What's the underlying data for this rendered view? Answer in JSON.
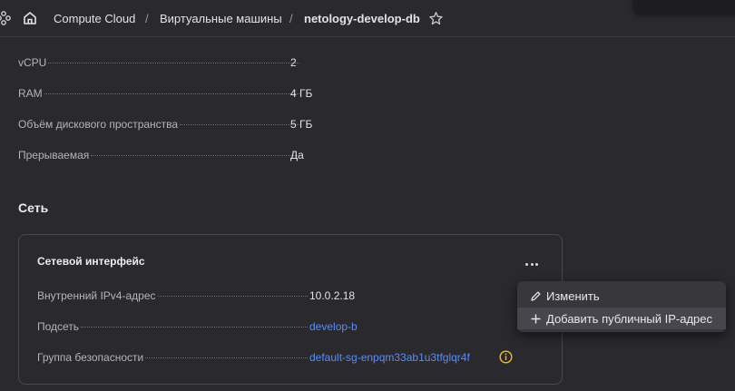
{
  "breadcrumb": {
    "items": [
      "Compute Cloud",
      "Виртуальные машины",
      "netology-develop-db"
    ],
    "separator": "/"
  },
  "vm_specs": [
    {
      "label": "vCPU",
      "value": "2"
    },
    {
      "label": "RAM",
      "value": "4 ГБ"
    },
    {
      "label": "Объём дискового пространства",
      "value": "5 ГБ"
    },
    {
      "label": "Прерываемая",
      "value": "Да"
    }
  ],
  "network": {
    "section_title": "Сеть",
    "interface": {
      "title": "Сетевой интерфейс",
      "fields": [
        {
          "label": "Внутренний IPv4-адрес",
          "value": "10.0.2.18"
        },
        {
          "label": "Подсеть",
          "value": "develop-b"
        },
        {
          "label": "Группа безопасности",
          "value": "default-sg-enpqm33ab1u3tfglqr4f"
        }
      ]
    }
  },
  "context_menu": {
    "items": [
      {
        "label": "Изменить",
        "icon": "pencil-icon"
      },
      {
        "label": "Добавить публичный IP-адрес",
        "icon": "plus-icon"
      }
    ]
  },
  "colors": {
    "background": "#29292e",
    "link": "#5b8df6",
    "warning": "#f2c21b"
  }
}
